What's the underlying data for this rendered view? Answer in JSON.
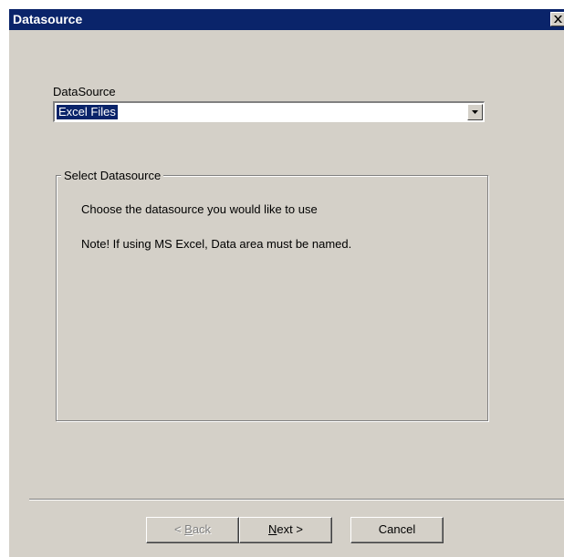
{
  "window": {
    "title": "Datasource"
  },
  "datasource": {
    "label": "DataSource",
    "selected": "Excel Files"
  },
  "group": {
    "title": "Select Datasource",
    "line1": "Choose the datasource you would like to use",
    "line2": "Note! If using MS Excel, Data area must be named."
  },
  "buttons": {
    "back_prefix": "< ",
    "back_mnemonic": "B",
    "back_rest": "ack",
    "next_mnemonic": "N",
    "next_rest": "ext >",
    "cancel": "Cancel"
  },
  "icons": {
    "close": "close-icon",
    "dropdown": "chevron-down-icon"
  },
  "colors": {
    "titlebar": "#0a246a",
    "dialog": "#d4d0c8",
    "selection": "#0a246a"
  }
}
